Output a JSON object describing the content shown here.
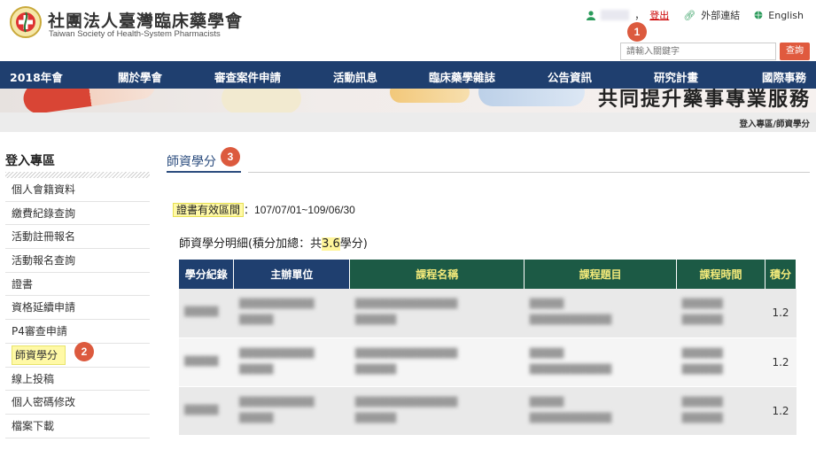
{
  "header": {
    "title": "社團法人臺灣臨床藥學會",
    "subtitle": "Taiwan Society of Health-System Pharmacists",
    "logout": "登出",
    "separator": "，",
    "external_links": "外部連結",
    "english": "English",
    "search_placeholder": "請輸入關鍵字",
    "search_button": "查詢"
  },
  "nav": [
    "2018年會",
    "關於學會",
    "審查案件申請",
    "活動訊息",
    "臨床藥學雜誌",
    "公告資訊",
    "研究計畫",
    "國際事務"
  ],
  "banner": {
    "text": "共同提升藥事專業服務"
  },
  "breadcrumb": "登入專區/師資學分",
  "sidebar": {
    "title": "登入專區",
    "items": [
      "個人會籍資料",
      "繳費紀錄查詢",
      "活動註冊報名",
      "活動報名查詢",
      "證書",
      "資格延續申請",
      "P4審查申請",
      "師資學分",
      "線上投稿",
      "個人密碼修改",
      "檔案下載"
    ]
  },
  "main": {
    "title": "師資學分",
    "validity_label": "證書有效區間",
    "validity_value": "：107/07/01~109/06/30",
    "summary_prefix": "師資學分明細(積分加總：共",
    "summary_total": "3.6",
    "summary_suffix": "學分)"
  },
  "table": {
    "headers": [
      "學分紀錄",
      "主辦單位",
      "課程名稱",
      "課程題目",
      "課程時間",
      "積分"
    ],
    "rows": [
      {
        "record": "",
        "organizer": "",
        "course": "",
        "topic": "",
        "time": "",
        "credit": "1.2"
      },
      {
        "record": "",
        "organizer": "",
        "course": "",
        "topic": "",
        "time": "",
        "credit": "1.2"
      },
      {
        "record": "",
        "organizer": "",
        "course": "",
        "topic": "",
        "time": "",
        "credit": "1.2"
      }
    ]
  },
  "annotations": [
    "1",
    "2",
    "3"
  ],
  "colors": {
    "nav_bg": "#1f3f6f",
    "accent": "#dc5a3e",
    "highlight": "#fff9a6",
    "green_header": "#1c5a45"
  }
}
